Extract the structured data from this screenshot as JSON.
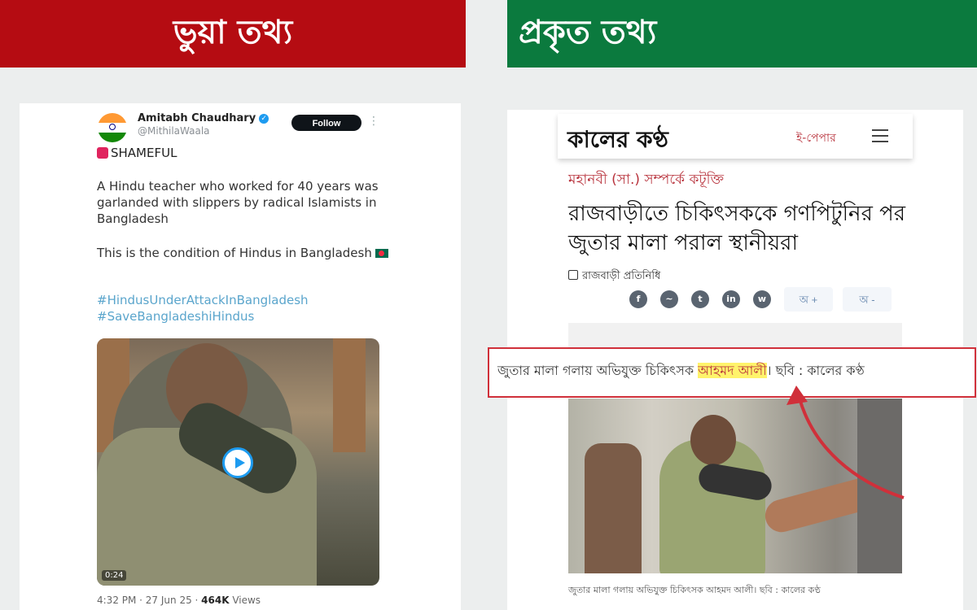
{
  "banners": {
    "fake": "ভুয়া তথ্য",
    "real": "প্রকৃত তথ্য"
  },
  "tweet": {
    "name": "Amitabh Chaudhary",
    "handle": "@MithilaWaala",
    "follow_label": "Follow",
    "alert": "SHAMEFUL",
    "text1": "A Hindu teacher who worked for 40 years was garlanded with slippers by radical Islamists in Bangladesh",
    "text2": "This is the condition of Hindus in Bangladesh",
    "hashtags": [
      "#HindusUnderAttackInBangladesh",
      "#SaveBangladeshiHindus"
    ],
    "video_duration": "0:24",
    "timestamp": "4:32 PM · 27 Jun 25 · ",
    "views_count": "464K",
    "views_label": " Views"
  },
  "news": {
    "logo": "কালের কণ্ঠ",
    "epaper": "ই-পেপার",
    "category": "মহানবী (সা.) সম্পর্কে কটূক্তি",
    "headline": "রাজবাড়ীতে চিকিৎসককে গণপিটুনির পর জুতার মালা পরাল স্থানীয়রা",
    "byline": "রাজবাড়ী প্রতিনিধি",
    "share_icons": [
      "facebook-icon",
      "messenger-icon",
      "twitter-icon",
      "linkedin-icon",
      "whatsapp-icon"
    ],
    "font_increase": "অ +",
    "font_decrease": "অ -",
    "caption": "জুতার মালা গলায় অভিযুক্ত চিকিৎসক আহমদ আলী। ছবি : কালের কণ্ঠ"
  },
  "callout": {
    "before": "জুতার মালা গলায় অভিযুক্ত চিকিৎসক ",
    "highlight": "আহমদ আলী",
    "after": "। ছবি : কালের কণ্ঠ"
  },
  "colors": {
    "fake_red": "#b50c12",
    "real_green": "#0b7a3e",
    "highlight": "#fff36b",
    "callout_border": "#d0303a"
  }
}
